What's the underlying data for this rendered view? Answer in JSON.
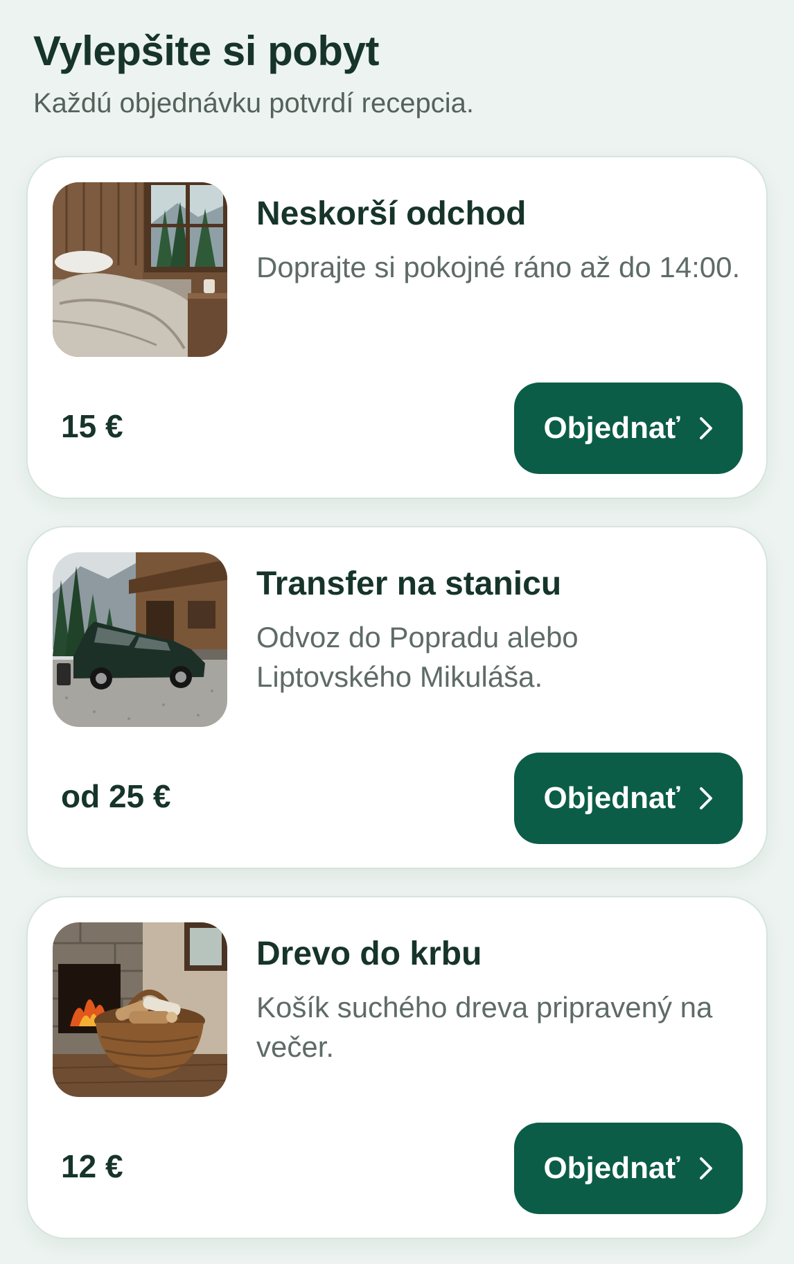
{
  "header": {
    "title": "Vylepšite si pobyt",
    "subtitle": "Každú objednávku potvrdí recepcia."
  },
  "cards": [
    {
      "title": "Neskorší odchod",
      "description": "Doprajte si pokojné ráno až do 14:00.",
      "price": "15 €",
      "button_label": "Objednať",
      "image": "bedroom-window-photo"
    },
    {
      "title": "Transfer na stanicu",
      "description": "Odvoz do Popradu alebo Liptovského Mikuláša.",
      "price": "od 25 €",
      "button_label": "Objednať",
      "image": "car-at-chalet-photo"
    },
    {
      "title": "Drevo do krbu",
      "description": "Košík suchého dreva pripravený na večer.",
      "price": "12 €",
      "button_label": "Objednať",
      "image": "firewood-basket-photo"
    }
  ],
  "colors": {
    "accent": "#0b5d47",
    "background": "#ecf3f0",
    "card": "#ffffff",
    "title_text": "#16342a",
    "muted_text": "#5e6b66"
  },
  "icons": {
    "button": "chevron-right-icon"
  }
}
